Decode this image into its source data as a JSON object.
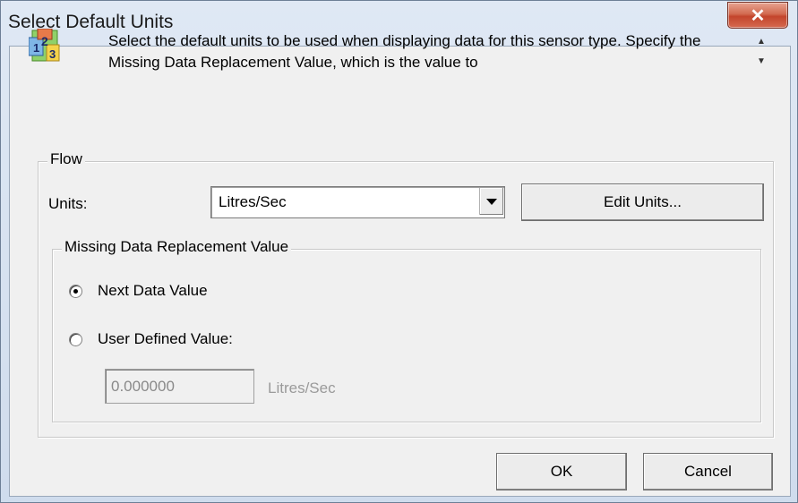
{
  "window": {
    "title": "Select Default Units",
    "close_glyph": "✕"
  },
  "info": {
    "text": "Select the default units to be used when displaying data for this sensor type. Specify the Missing Data Replacement Value, which is the value to",
    "scroll_up": "▲",
    "scroll_down": "▼"
  },
  "flow_group": {
    "legend": "Flow",
    "units_label": "Units:",
    "units_selected": "Litres/Sec",
    "edit_units_button": "Edit Units..."
  },
  "missing_group": {
    "legend": "Missing Data Replacement Value",
    "option_next": "Next Data Value",
    "option_user": "User Defined Value:",
    "selected": "next",
    "value": "0.000000",
    "value_units": "Litres/Sec"
  },
  "buttons": {
    "ok": "OK",
    "cancel": "Cancel"
  },
  "colors": {
    "titlebar_bg": "#dfe8f4",
    "close_button": "#c3452c",
    "dialog_bg": "#f0f0f0"
  },
  "icons": {
    "app_icon": "numbers-123-icon",
    "close_icon": "close-icon",
    "dropdown_icon": "chevron-down-icon"
  }
}
